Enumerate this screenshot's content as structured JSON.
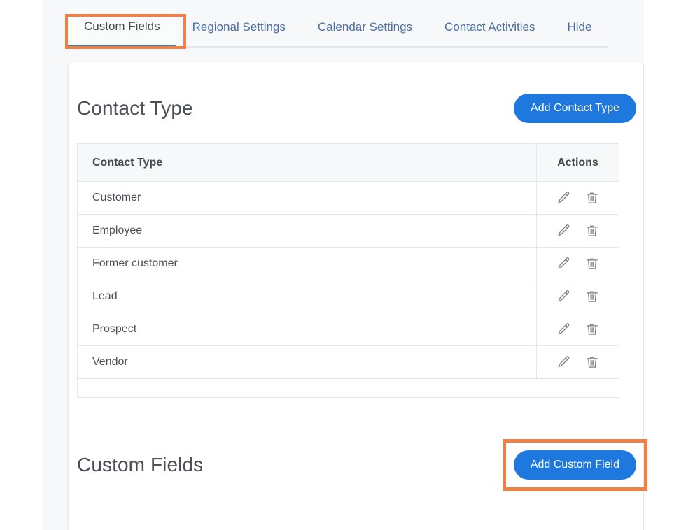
{
  "tabs": [
    {
      "label": "Custom Fields",
      "active": true,
      "highlighted": true
    },
    {
      "label": "Regional Settings",
      "active": false,
      "highlighted": false
    },
    {
      "label": "Calendar Settings",
      "active": false,
      "highlighted": false
    },
    {
      "label": "Contact Activities",
      "active": false,
      "highlighted": false
    },
    {
      "label": "Hide",
      "active": false,
      "highlighted": false
    }
  ],
  "contact_type_section": {
    "title": "Contact Type",
    "add_button_label": "Add Contact Type",
    "table": {
      "columns": [
        "Contact Type",
        "Actions"
      ],
      "rows": [
        {
          "name": "Customer"
        },
        {
          "name": "Employee"
        },
        {
          "name": "Former customer"
        },
        {
          "name": "Lead"
        },
        {
          "name": "Prospect"
        },
        {
          "name": "Vendor"
        }
      ],
      "row_action_icons": [
        "pencil-icon",
        "trash-icon"
      ]
    }
  },
  "custom_fields_section": {
    "title": "Custom Fields",
    "add_button_label": "Add Custom Field",
    "add_button_highlighted": true
  },
  "colors": {
    "primary_button": "#1f78dd",
    "highlight_outline": "#f08043",
    "active_tab_underline": "#3681c4",
    "tab_link_text": "#4a6fa5",
    "heading_text": "#4b5057",
    "page_background": "#f7f8f9",
    "card_background": "#ffffff",
    "table_header_background": "#f7f8f9",
    "table_border": "#e4e7e9"
  }
}
